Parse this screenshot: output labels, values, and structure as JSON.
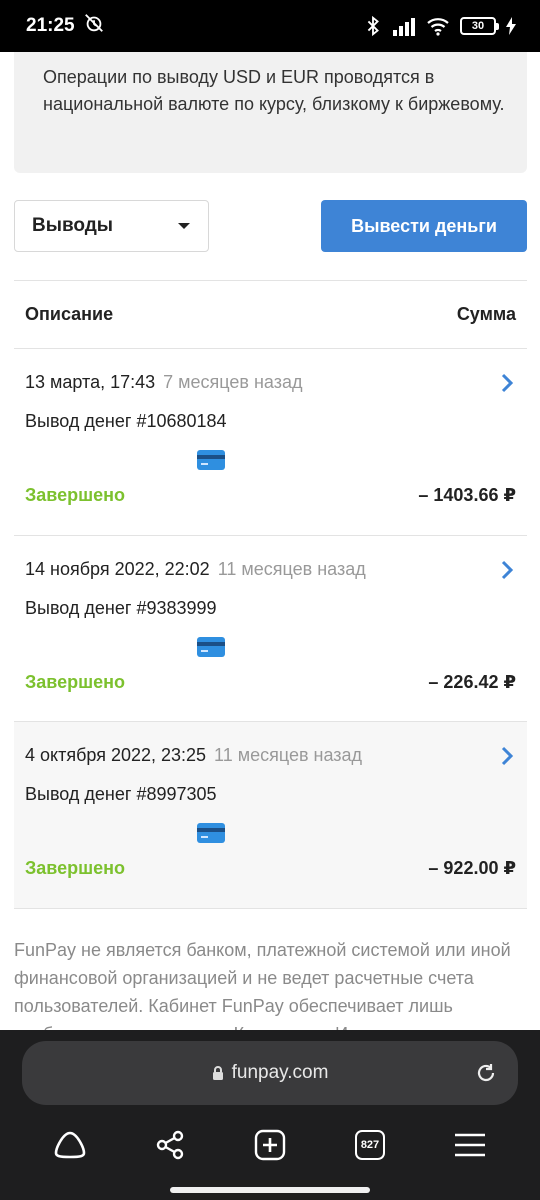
{
  "status_bar": {
    "time": "21:25",
    "battery": "30"
  },
  "notice": {
    "text": "Операции по выводу USD и EUR проводятся в национальной валюте по курсу, близкому к биржевому."
  },
  "filter": {
    "selected": "Выводы"
  },
  "withdraw_button": {
    "label": "Вывести деньги"
  },
  "table": {
    "col_description": "Описание",
    "col_amount": "Сумма"
  },
  "rows": [
    {
      "date": "13 марта, 17:43",
      "ago": "7 месяцев назад",
      "title": "Вывод денег #10680184",
      "status": "Завершено",
      "amount": "– 1403.66 ₽"
    },
    {
      "date": "14 ноября 2022, 22:02",
      "ago": "11 месяцев назад",
      "title": "Вывод денег #9383999",
      "status": "Завершено",
      "amount": "– 226.42 ₽"
    },
    {
      "date": "4 октября 2022, 23:25",
      "ago": "11 месяцев назад",
      "title": "Вывод денег #8997305",
      "status": "Завершено",
      "amount": "– 922.00 ₽"
    }
  ],
  "footer": {
    "text": "FunPay не является банком, платежной системой или иной финансовой организацией и не ведет расчетные счета пользователей. Кабинет FunPay обеспечивает лишь удобство расчетов между Клиентами, Игроками и"
  },
  "browser": {
    "url": "funpay.com",
    "tabs_count": "827"
  },
  "colors": {
    "accent": "#3e84d6",
    "status_done": "#7cc12e",
    "chevron": "#3e84d6"
  }
}
